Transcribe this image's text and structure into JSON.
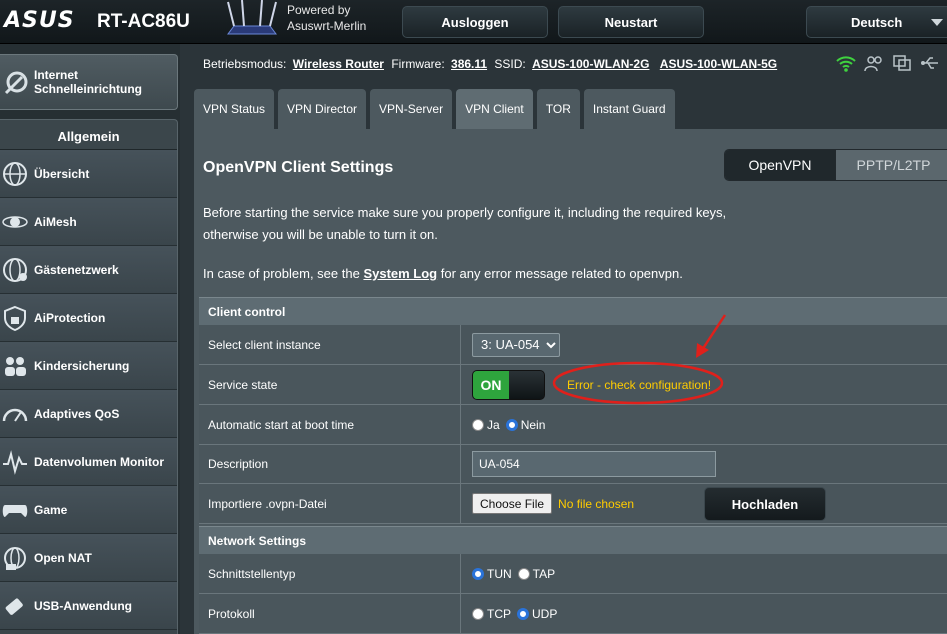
{
  "header": {
    "logo": "ASUS",
    "model": "RT-AC86U",
    "powered_line1": "Powered by",
    "powered_line2": "Asuswrt-Merlin",
    "logout": "Ausloggen",
    "reboot": "Neustart",
    "language": "Deutsch"
  },
  "sidebar": {
    "quick_setup_line1": "Internet",
    "quick_setup_line2": "Schnelleinrichtung",
    "section_title": "Allgemein",
    "items": [
      {
        "label": "Übersicht",
        "icon": "globe-network-icon"
      },
      {
        "label": "AiMesh",
        "icon": "mesh-icon"
      },
      {
        "label": "Gästenetzwerk",
        "icon": "guest-network-icon"
      },
      {
        "label": "AiProtection",
        "icon": "shield-lock-icon"
      },
      {
        "label": "Kindersicherung",
        "icon": "parental-control-icon"
      },
      {
        "label": "Adaptives QoS",
        "icon": "gauge-icon"
      },
      {
        "label": "Datenvolumen Monitor",
        "icon": "traffic-monitor-icon"
      },
      {
        "label": "Game",
        "icon": "gamepad-icon"
      },
      {
        "label": "Open NAT",
        "icon": "open-nat-icon"
      },
      {
        "label": "USB-Anwendung",
        "icon": "usb-icon"
      }
    ]
  },
  "infobar": {
    "mode_label": "Betriebsmodus:",
    "mode_value": "Wireless Router",
    "fw_label": "Firmware:",
    "fw_value": "386.11",
    "ssid_label": "SSID:",
    "ssid_2g": "ASUS-100-WLAN-2G",
    "ssid_5g": "ASUS-100-WLAN-5G"
  },
  "tabs": [
    "VPN Status",
    "VPN Director",
    "VPN-Server",
    "VPN Client",
    "TOR",
    "Instant Guard"
  ],
  "main": {
    "title": "OpenVPN Client Settings",
    "switch_openvpn": "OpenVPN",
    "switch_pptp": "PPTP/L2TP",
    "intro_line1": "Before starting the service make sure you properly configure it, including the required keys,",
    "intro_line2": "otherwise you will be unable to turn it on.",
    "problem_prefix": "In case of problem, see the",
    "problem_link": "System Log",
    "problem_suffix": "for any error message related to openvpn.",
    "client_control": {
      "section": "Client control",
      "select_label": "Select client instance",
      "select_value": "3: UA-054",
      "service_label": "Service state",
      "toggle_on": "ON",
      "error_text": "Error - check configuration!",
      "autostart_label": "Automatic start at boot time",
      "opt_yes": "Ja",
      "opt_no": "Nein",
      "desc_label": "Description",
      "desc_value": "UA-054",
      "import_label": "Importiere .ovpn-Datei",
      "choose_file": "Choose File",
      "no_file": "No file chosen",
      "upload": "Hochladen"
    },
    "network": {
      "section": "Network Settings",
      "iface_label": "Schnittstellentyp",
      "opt_tun": "TUN",
      "opt_tap": "TAP",
      "proto_label": "Protokoll",
      "opt_tcp": "TCP",
      "opt_udp": "UDP"
    }
  },
  "colors": {
    "error": "#ffcc00",
    "toggle_on": "#2ea43d",
    "annotation": "#e0201b"
  }
}
